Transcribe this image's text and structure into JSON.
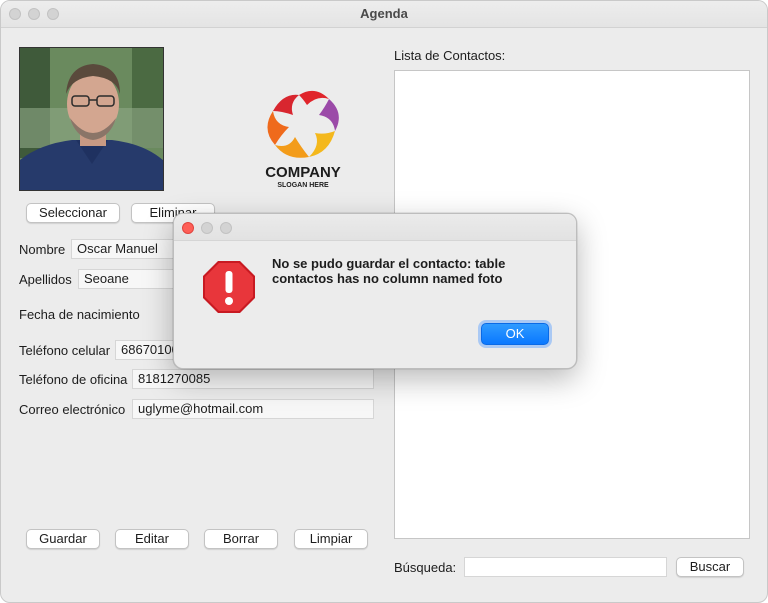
{
  "window": {
    "title": "Agenda"
  },
  "photo_panel": {
    "select_label": "Seleccionar",
    "delete_label": "Eliminar"
  },
  "logo": {
    "name": "COMPANY",
    "slogan": "SLOGAN HERE"
  },
  "form": {
    "nombre_label": "Nombre",
    "nombre_value": "Oscar Manuel",
    "apellidos_label": "Apellidos",
    "apellidos_value": "Seoane",
    "fecha_label": "Fecha de nacimiento",
    "celular_label": "Teléfono celular",
    "celular_value": "68670100",
    "oficina_label": "Teléfono de oficina",
    "oficina_value": "8181270085",
    "correo_label": "Correo electrónico",
    "correo_value": "uglyme@hotmail.com"
  },
  "actions": {
    "save": "Guardar",
    "edit": "Editar",
    "delete": "Borrar",
    "clear": "Limpiar"
  },
  "contacts": {
    "title": "Lista de Contactos:",
    "items": []
  },
  "search": {
    "label": "Búsqueda:",
    "value": "",
    "button": "Buscar"
  },
  "dialog": {
    "message": "No se pudo guardar el contacto: table contactos has no column named foto",
    "ok_label": "OK",
    "icon": "stop-icon"
  },
  "colors": {
    "accent": "#0a78ff",
    "error": "#e0252b",
    "window_bg": "#ececec"
  }
}
